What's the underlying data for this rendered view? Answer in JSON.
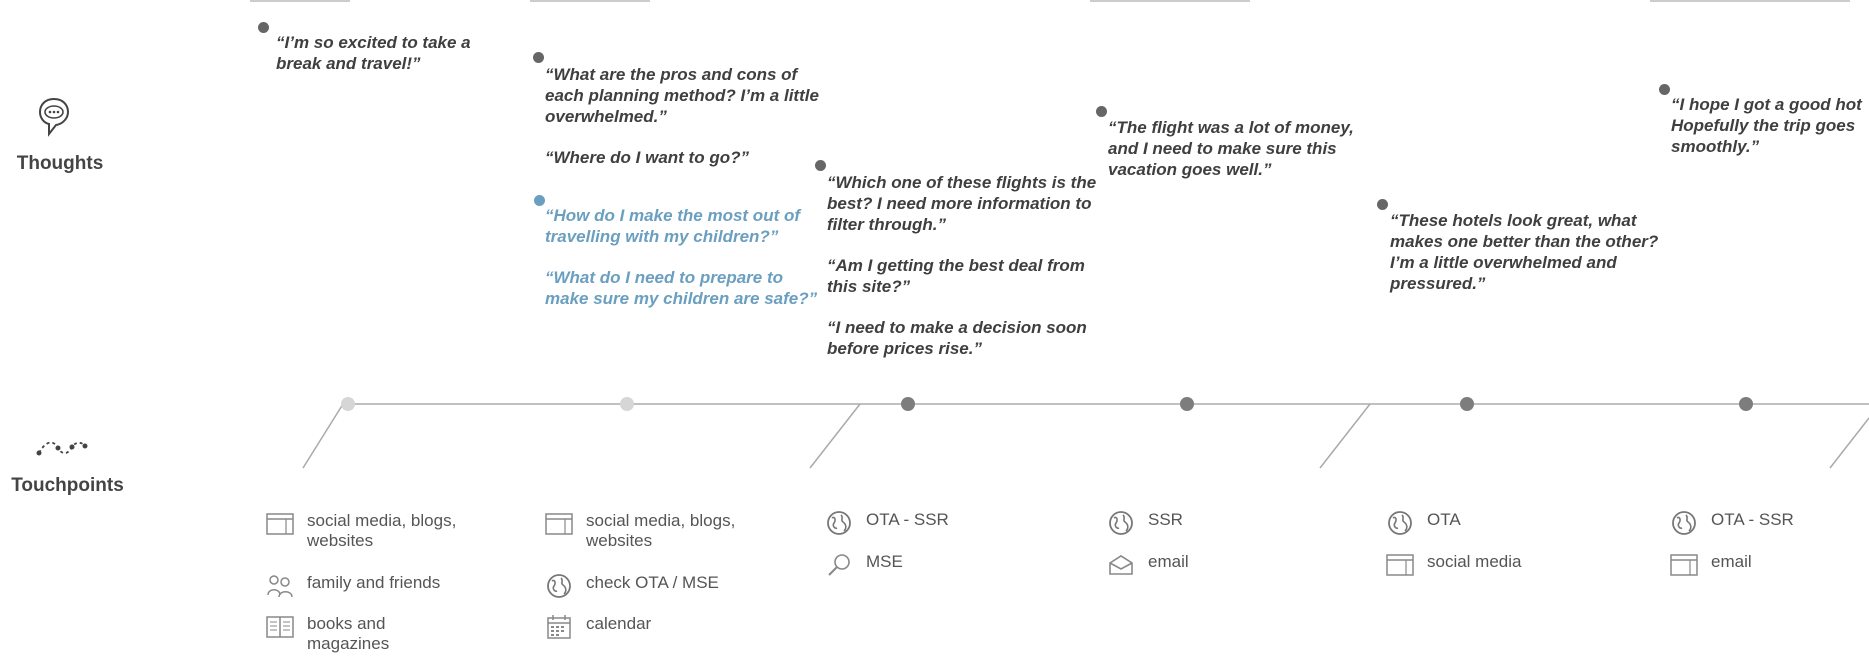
{
  "rows": {
    "thoughts_label": "Thoughts",
    "touchpoints_label": "Touchpoints"
  },
  "thoughts": [
    {
      "lines": [
        "“I’m so excited to take a break and travel!”"
      ]
    },
    {
      "lines": [
        "“What are the pros and cons of each planning method? I’m a little overwhelmed.”",
        "“Where do I want to go?”"
      ]
    },
    {
      "lines": [
        "“How do I make the most out of travelling with my children?”",
        "“What do I need to prepare to make sure my children are safe?”"
      ]
    },
    {
      "lines": [
        "“Which one of these flights is the best? I need more information to filter through.”",
        "“Am I getting the best deal from this site?”",
        "“I need to make a decision soon before prices rise.”"
      ]
    },
    {
      "lines": [
        "“The flight was a lot of money, and I need to make sure this vacation goes well.”"
      ]
    },
    {
      "lines": [
        "“These hotels look great, what makes one better than the other? I’m a little overwhelmed and pressured.”"
      ]
    },
    {
      "lines": [
        "“I hope I got a good hot Hopefully the trip goes smoothly.”"
      ]
    }
  ],
  "timeline_colors": [
    "#d6d6d6",
    "#d6d6d6",
    "#7d7d7d",
    "#7d7d7d",
    "#7d7d7d",
    "#7d7d7d"
  ],
  "touchpoints": [
    [
      {
        "icon": "browser-window-icon",
        "label": "social media, blogs, websites"
      },
      {
        "icon": "people-icon",
        "label": "family and friends"
      },
      {
        "icon": "book-icon",
        "label": "books and magazines"
      }
    ],
    [
      {
        "icon": "browser-window-icon",
        "label": "social media, blogs, websites"
      },
      {
        "icon": "globe-icon",
        "label": "check OTA / MSE"
      },
      {
        "icon": "calendar-icon",
        "label": "calendar"
      }
    ],
    [
      {
        "icon": "globe-icon",
        "label": "OTA - SSR"
      },
      {
        "icon": "magnifier-icon",
        "label": "MSE"
      }
    ],
    [
      {
        "icon": "globe-icon",
        "label": "SSR"
      },
      {
        "icon": "envelope-icon",
        "label": "email"
      }
    ],
    [
      {
        "icon": "globe-icon",
        "label": "OTA"
      },
      {
        "icon": "browser-window-icon",
        "label": "social media"
      }
    ],
    [
      {
        "icon": "globe-icon",
        "label": "OTA - SSR"
      },
      {
        "icon": "browser-window-icon",
        "label": "email"
      }
    ]
  ]
}
